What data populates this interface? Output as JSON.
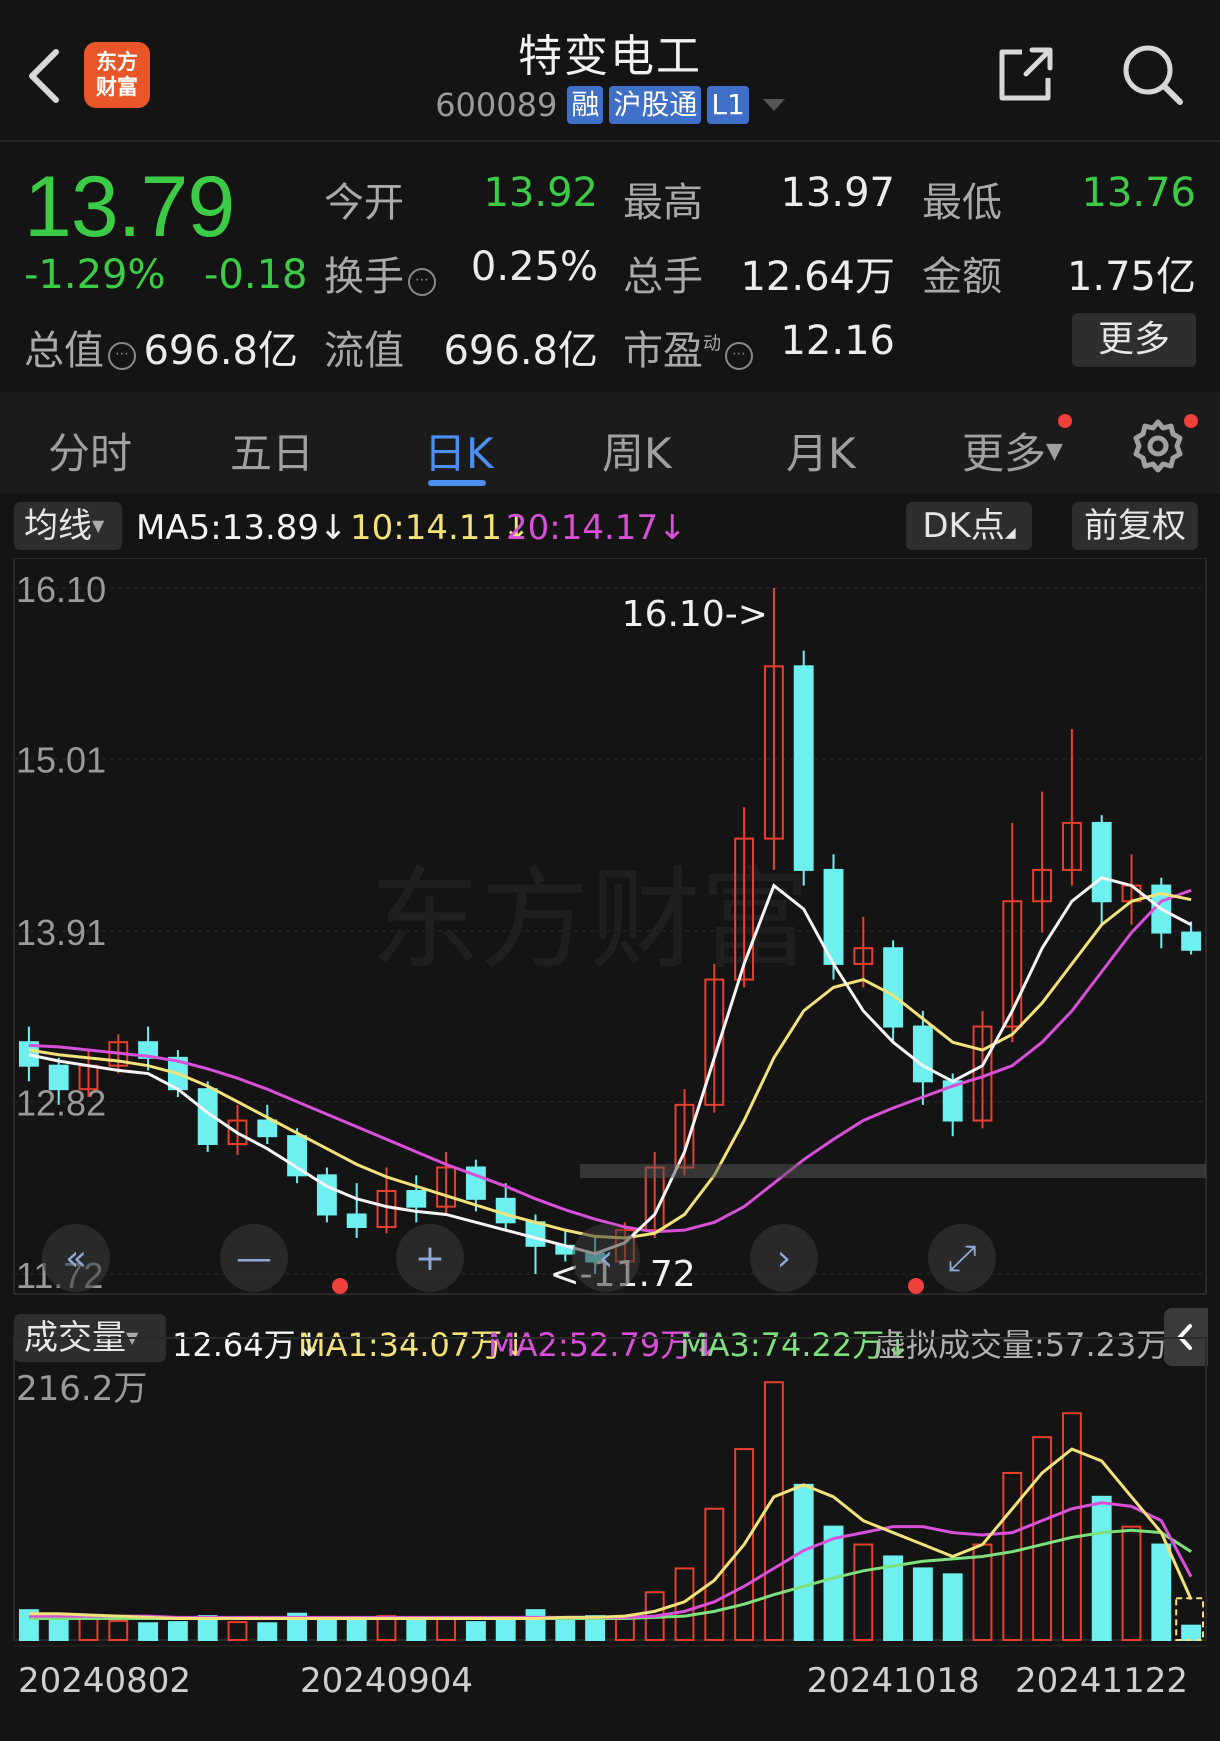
{
  "header": {
    "title": "特变电工",
    "code": "600089",
    "badges": [
      "融",
      "沪股通",
      "L1"
    ],
    "logo_text": [
      "东方",
      "财富"
    ]
  },
  "quote": {
    "price": "13.79",
    "change_pct": "-1.29%",
    "change": "-0.18",
    "rows": [
      [
        {
          "label": "今开",
          "value": "13.92"
        },
        {
          "label": "最高",
          "value": "13.97"
        },
        {
          "label": "最低",
          "value": "13.76"
        }
      ],
      [
        {
          "label": "换手",
          "value": "0.25%"
        },
        {
          "label": "总手",
          "value": "12.64万"
        },
        {
          "label": "金额",
          "value": "1.75亿"
        }
      ],
      [
        {
          "label": "总值",
          "value": "696.8亿"
        },
        {
          "label": "流值",
          "value": "696.8亿"
        },
        {
          "label": "市盈",
          "value": "12.16",
          "sup": "动"
        }
      ]
    ],
    "more_label": "更多"
  },
  "tabs": [
    "分时",
    "五日",
    "日K",
    "周K",
    "月K",
    "更多"
  ],
  "active_tab": "日K",
  "ma_bar": {
    "selector": "均线",
    "ma5": "MA5:13.89",
    "ma10": "10:14.11",
    "ma20": "20:14.17",
    "dk_label": "DK点",
    "adjust_label": "前复权"
  },
  "volume_bar": {
    "selector": "成交量",
    "vol": "12.64万",
    "ma1": "MA1:34.07万",
    "ma2": "MA2:52.79万",
    "ma3": "MA3:74.22万",
    "virtual": "虚拟成交量:57.23万"
  },
  "colors": {
    "up": "#e8402f",
    "down": "#6ff0f0",
    "ma5": "#f4f4f4",
    "ma10": "#f2e27a",
    "ma20": "#d84fd8",
    "ma3": "#7de07d"
  },
  "chart_data": {
    "type": "candlestick",
    "price_ticks": [
      "16.10",
      "15.01",
      "13.91",
      "12.82",
      "11.72"
    ],
    "price_range": [
      11.72,
      16.1
    ],
    "high_marker": "16.10->",
    "low_marker": "<-11.72",
    "volume_max_label": "216.2万",
    "volume_max": 216.2,
    "x_labels": [
      "20240802",
      "20240904",
      "20241018",
      "20241122"
    ],
    "x_label_index": [
      3,
      12,
      29,
      38
    ],
    "candles": [
      [
        13.2,
        13.05,
        13.3,
        12.95,
        25
      ],
      [
        13.05,
        12.9,
        13.1,
        12.8,
        22
      ],
      [
        12.9,
        13.05,
        13.15,
        12.85,
        18
      ],
      [
        13.05,
        13.2,
        13.25,
        13.0,
        16
      ],
      [
        13.2,
        13.1,
        13.3,
        13.02,
        14
      ],
      [
        13.1,
        12.9,
        13.15,
        12.85,
        15
      ],
      [
        12.9,
        12.55,
        12.95,
        12.5,
        20
      ],
      [
        12.55,
        12.7,
        12.8,
        12.48,
        15
      ],
      [
        12.7,
        12.6,
        12.8,
        12.55,
        14
      ],
      [
        12.6,
        12.35,
        12.65,
        12.3,
        22
      ],
      [
        12.35,
        12.1,
        12.4,
        12.05,
        19
      ],
      [
        12.1,
        12.02,
        12.3,
        11.95,
        18
      ],
      [
        12.02,
        12.25,
        12.4,
        11.98,
        20
      ],
      [
        12.25,
        12.15,
        12.35,
        12.05,
        16
      ],
      [
        12.15,
        12.4,
        12.5,
        12.1,
        18
      ],
      [
        12.4,
        12.2,
        12.45,
        12.12,
        15
      ],
      [
        12.2,
        12.05,
        12.3,
        12.0,
        16
      ],
      [
        12.05,
        11.9,
        12.1,
        11.72,
        25
      ],
      [
        11.9,
        11.85,
        12.0,
        11.8,
        17
      ],
      [
        11.85,
        11.8,
        11.95,
        11.72,
        20
      ],
      [
        11.8,
        12.0,
        12.05,
        11.78,
        18
      ],
      [
        12.0,
        12.4,
        12.5,
        11.95,
        40
      ],
      [
        12.4,
        12.8,
        12.9,
        12.35,
        60
      ],
      [
        12.8,
        13.6,
        13.7,
        12.75,
        110
      ],
      [
        13.6,
        14.5,
        14.7,
        13.55,
        160
      ],
      [
        14.5,
        15.6,
        16.1,
        14.3,
        216
      ],
      [
        15.6,
        14.3,
        15.7,
        14.2,
        130
      ],
      [
        14.3,
        13.7,
        14.4,
        13.6,
        95
      ],
      [
        13.7,
        13.8,
        14.0,
        13.55,
        80
      ],
      [
        13.8,
        13.3,
        13.85,
        13.2,
        70
      ],
      [
        13.3,
        12.95,
        13.4,
        12.8,
        60
      ],
      [
        12.95,
        12.7,
        13.0,
        12.6,
        55
      ],
      [
        12.7,
        13.3,
        13.4,
        12.65,
        80
      ],
      [
        13.3,
        14.1,
        14.6,
        13.2,
        140
      ],
      [
        14.1,
        14.3,
        14.8,
        13.9,
        170
      ],
      [
        14.3,
        14.6,
        15.2,
        14.2,
        190
      ],
      [
        14.6,
        14.1,
        14.65,
        13.95,
        120
      ],
      [
        14.1,
        14.2,
        14.4,
        13.95,
        95
      ],
      [
        14.2,
        13.9,
        14.25,
        13.8,
        80
      ],
      [
        13.9,
        13.79,
        13.97,
        13.76,
        12
      ]
    ],
    "ma5": [
      13.12,
      13.08,
      13.05,
      13.02,
      13.0,
      12.9,
      12.75,
      12.62,
      12.52,
      12.4,
      12.28,
      12.2,
      12.15,
      12.12,
      12.1,
      12.05,
      12.0,
      11.95,
      11.9,
      11.85,
      11.92,
      12.1,
      12.5,
      13.1,
      13.7,
      14.2,
      14.05,
      13.7,
      13.4,
      13.2,
      13.05,
      12.95,
      13.05,
      13.4,
      13.8,
      14.1,
      14.25,
      14.2,
      14.05,
      13.95
    ],
    "ma10": [
      13.15,
      13.12,
      13.1,
      13.08,
      13.05,
      13.0,
      12.92,
      12.82,
      12.72,
      12.62,
      12.52,
      12.42,
      12.34,
      12.28,
      12.22,
      12.16,
      12.1,
      12.05,
      12.0,
      11.96,
      11.95,
      11.98,
      12.1,
      12.35,
      12.7,
      13.1,
      13.4,
      13.55,
      13.6,
      13.5,
      13.35,
      13.2,
      13.15,
      13.25,
      13.45,
      13.7,
      13.95,
      14.1,
      14.15,
      14.11
    ],
    "ma20": [
      13.18,
      13.17,
      13.15,
      13.13,
      13.11,
      13.08,
      13.03,
      12.97,
      12.9,
      12.82,
      12.74,
      12.66,
      12.58,
      12.5,
      12.42,
      12.35,
      12.28,
      12.2,
      12.13,
      12.07,
      12.02,
      11.99,
      12.0,
      12.05,
      12.15,
      12.3,
      12.45,
      12.58,
      12.7,
      12.78,
      12.85,
      12.92,
      12.98,
      13.05,
      13.2,
      13.4,
      13.65,
      13.9,
      14.1,
      14.17
    ],
    "vol_ma1": [
      22,
      22,
      21,
      20,
      19,
      18,
      18,
      18,
      18,
      18,
      18,
      18,
      18,
      18,
      18,
      18,
      18,
      18,
      19,
      19,
      20,
      24,
      32,
      50,
      80,
      120,
      130,
      120,
      100,
      90,
      80,
      70,
      80,
      110,
      140,
      160,
      150,
      120,
      90,
      34
    ],
    "vol_ma2": [
      20,
      20,
      20,
      20,
      20,
      19,
      19,
      19,
      19,
      19,
      19,
      19,
      19,
      19,
      19,
      19,
      19,
      19,
      19,
      19,
      19,
      20,
      24,
      32,
      45,
      60,
      75,
      85,
      90,
      95,
      95,
      90,
      88,
      90,
      100,
      110,
      115,
      112,
      100,
      53
    ],
    "vol_ma3": [
      18,
      18,
      18,
      18,
      18,
      18,
      18,
      18,
      18,
      18,
      18,
      18,
      18,
      18,
      18,
      18,
      18,
      18,
      18,
      18,
      18,
      19,
      20,
      24,
      30,
      38,
      45,
      52,
      58,
      62,
      66,
      68,
      70,
      74,
      80,
      86,
      90,
      92,
      90,
      74
    ]
  }
}
